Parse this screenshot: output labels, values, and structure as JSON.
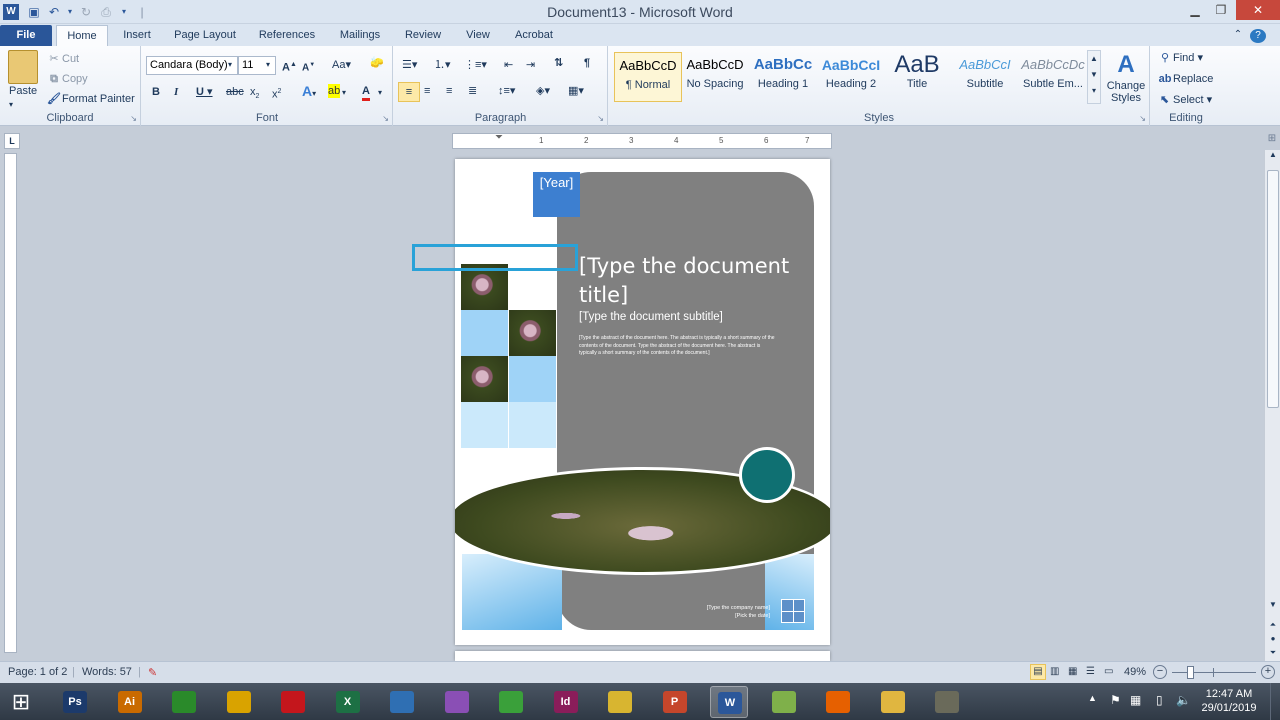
{
  "window": {
    "title": "Document13 - Microsoft Word",
    "help": "?"
  },
  "tabs": [
    "File",
    "Home",
    "Insert",
    "Page Layout",
    "References",
    "Mailings",
    "Review",
    "View",
    "Acrobat"
  ],
  "ribbon": {
    "clipboard": {
      "label": "Clipboard",
      "paste": "Paste",
      "cut": "Cut",
      "copy": "Copy",
      "format_painter": "Format Painter"
    },
    "font": {
      "label": "Font",
      "font_name": "Candara (Body)",
      "font_size": "11"
    },
    "paragraph": {
      "label": "Paragraph"
    },
    "styles": {
      "label": "Styles",
      "items": [
        {
          "preview": "AaBbCcD",
          "name": "¶ Normal"
        },
        {
          "preview": "AaBbCcD",
          "name": "No Spacing"
        },
        {
          "preview": "AaBbCc",
          "name": "Heading 1"
        },
        {
          "preview": "AaBbCcI",
          "name": "Heading 2"
        },
        {
          "preview": "AaB",
          "name": "Title"
        },
        {
          "preview": "AaBbCcI",
          "name": "Subtitle"
        },
        {
          "preview": "AaBbCcDc",
          "name": "Subtle Em..."
        }
      ],
      "change_styles": "Change Styles"
    },
    "editing": {
      "label": "Editing",
      "find": "Find",
      "replace": "Replace",
      "select": "Select"
    }
  },
  "ruler": {
    "h_ticks": [
      "1",
      "2",
      "3",
      "4",
      "5",
      "6",
      "7"
    ]
  },
  "document": {
    "year": "[Year]",
    "title": "[Type the document title]",
    "subtitle": "[Type the document subtitle]",
    "abstract": "[Type the abstract of the document here. The abstract is typically a short summary of the contents of the document. Type the abstract of the document here. The abstract is typically a short summary of the contents of the document.]",
    "company": "[Type the company name]",
    "date": "[Pick the date]"
  },
  "status": {
    "page": "Page: 1 of 2",
    "words": "Words: 57",
    "zoom": "49%",
    "zoom_level": 0.49
  },
  "taskbar": {
    "apps": [
      {
        "name": "ps",
        "label": "Ps",
        "color": "#1c3a6b"
      },
      {
        "name": "ai",
        "label": "Ai",
        "color": "#c96a00"
      },
      {
        "name": "store",
        "label": "",
        "color": "#2a8a2a"
      },
      {
        "name": "chrome",
        "label": "",
        "color": "#d9a300"
      },
      {
        "name": "opera",
        "label": "",
        "color": "#c4161c"
      },
      {
        "name": "excel",
        "label": "X",
        "color": "#1d7044"
      },
      {
        "name": "camera",
        "label": "",
        "color": "#2f6fb3"
      },
      {
        "name": "photos",
        "label": "",
        "color": "#8a4fb5"
      },
      {
        "name": "green-app",
        "label": "",
        "color": "#3aa03a"
      },
      {
        "name": "indesign",
        "label": "Id",
        "color": "#8a1d5a"
      },
      {
        "name": "lync",
        "label": "",
        "color": "#d8b530"
      },
      {
        "name": "powerpoint",
        "label": "P",
        "color": "#c5462b"
      },
      {
        "name": "word",
        "label": "W",
        "color": "#2b579a"
      },
      {
        "name": "notes",
        "label": "",
        "color": "#7fb04a"
      },
      {
        "name": "firefox",
        "label": "",
        "color": "#e66000"
      },
      {
        "name": "explorer",
        "label": "",
        "color": "#e0b640"
      },
      {
        "name": "media",
        "label": "",
        "color": "#6a6a5a"
      }
    ],
    "time": "12:47 AM",
    "date": "29/01/2019"
  }
}
